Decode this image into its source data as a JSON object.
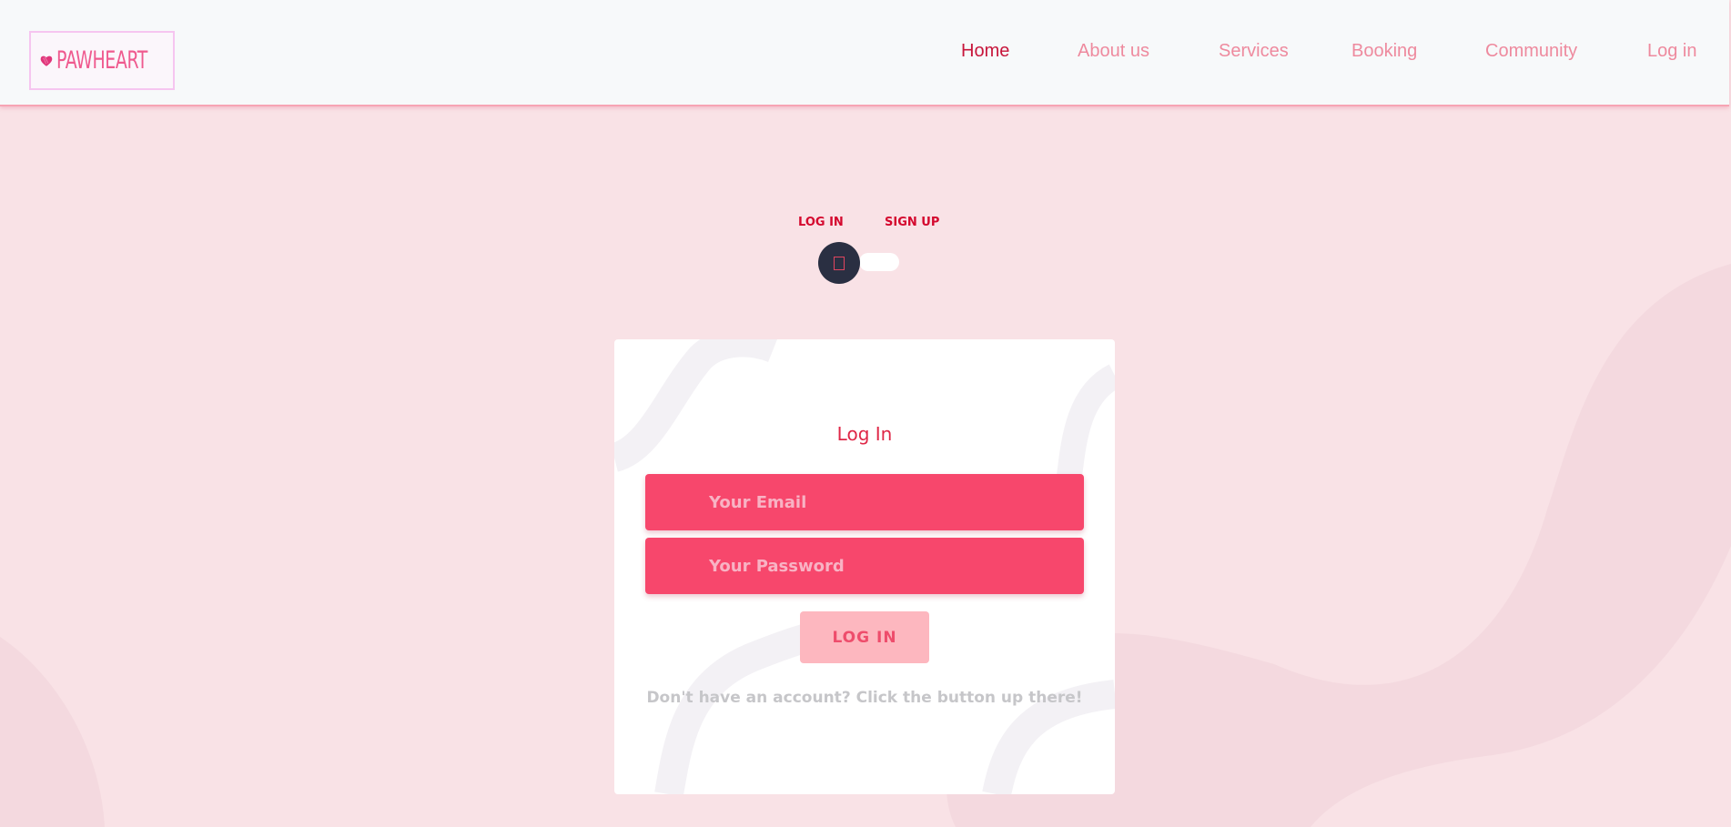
{
  "header": {
    "logo_text": "PAWHEART",
    "nav": [
      {
        "label": "Home",
        "active": true
      },
      {
        "label": "About us",
        "active": false
      },
      {
        "label": "Services",
        "active": false
      },
      {
        "label": "Booking",
        "active": false
      },
      {
        "label": "Community",
        "active": false
      },
      {
        "label": "Log in",
        "active": false
      }
    ]
  },
  "toggle": {
    "left_label": "LOG IN",
    "right_label": "SIGN UP",
    "selected": "LOG IN"
  },
  "form": {
    "title": "Log In",
    "email_placeholder": "Your Email",
    "email_value": "",
    "password_placeholder": "Your Password",
    "password_value": "",
    "submit_label": "LOG IN",
    "hint": "Don't have an account? Click the button up there!"
  },
  "colors": {
    "page_background": "#f9e2e6",
    "accent": "#f7476c",
    "nav_active": "#c7163b",
    "nav_inactive": "#ee8a9e",
    "toggle_knob": "#2a2f42"
  }
}
